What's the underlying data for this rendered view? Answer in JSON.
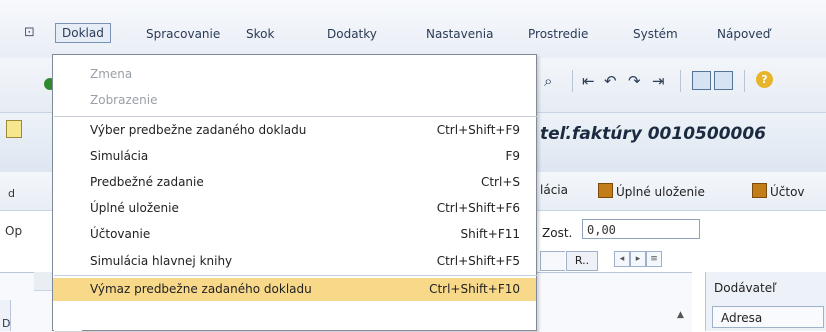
{
  "menubar": {
    "items": [
      {
        "label": "Doklad",
        "active": true
      },
      {
        "label": "Spracovanie"
      },
      {
        "label": "Skok"
      },
      {
        "label": "Dodatky"
      },
      {
        "label": "Nastavenia"
      },
      {
        "label": "Prostredie"
      },
      {
        "label": "Systém"
      },
      {
        "label": "Nápoveď"
      }
    ]
  },
  "title": {
    "text": "teľ.faktúry 0010500006"
  },
  "app_toolbar": {
    "left_text": "d",
    "simulation": "lácia",
    "full_save": "Úplné uloženie",
    "posting": "Účtov"
  },
  "form": {
    "op_label": "Op",
    "zost_label": "Zost.",
    "zost_value": "0,00",
    "tab_label": "R..",
    "left_stub": "D",
    "dodavatel_label": "Dodávateľ",
    "adresa_label": "Adresa"
  },
  "dropdown": {
    "items": [
      {
        "label": "Zmena",
        "shortcut": "",
        "disabled": true
      },
      {
        "label": "Zobrazenie",
        "shortcut": "",
        "disabled": true
      },
      {
        "label": "Výber predbežne zadaného dokladu",
        "shortcut": "Ctrl+Shift+F9"
      },
      {
        "label": "Simulácia",
        "shortcut": "F9"
      },
      {
        "label": "Predbežné zadanie",
        "shortcut": "Ctrl+S"
      },
      {
        "label": "Úplné uloženie",
        "shortcut": "Ctrl+Shift+F6"
      },
      {
        "label": "Účtovanie",
        "shortcut": "Shift+F11"
      },
      {
        "label": "Simulácia hlavnej knihy",
        "shortcut": "Ctrl+Shift+F5"
      },
      {
        "label": "Výmaz predbežne zadaného dokladu",
        "shortcut": "Ctrl+Shift+F10",
        "selected": true
      }
    ]
  },
  "colors": {
    "highlight": "#f8d98a",
    "menubar_text": "#2a3b55"
  }
}
